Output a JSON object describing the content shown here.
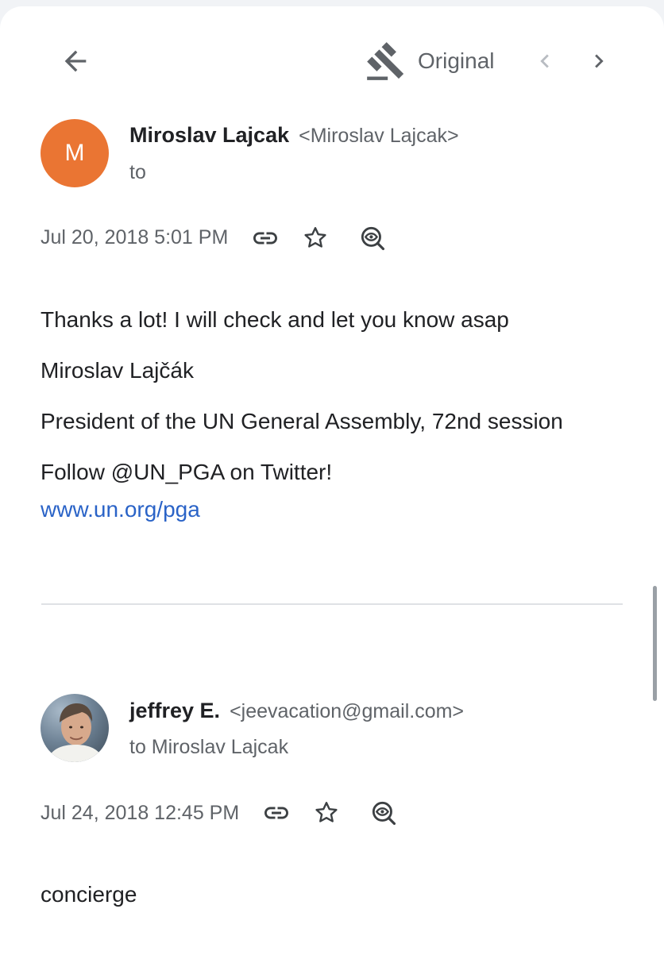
{
  "toolbar": {
    "back_icon": "arrow-back-icon",
    "original_icon": "gavel-icon",
    "original_label": "Original",
    "prev_icon": "chevron-left-icon",
    "next_icon": "chevron-right-icon"
  },
  "messages": [
    {
      "avatar_letter": "M",
      "avatar_color": "#ea7533",
      "sender_name": "Miroslav Lajcak",
      "sender_email": "<Miroslav Lajcak>",
      "recipient": "to",
      "timestamp": "Jul 20, 2018 5:01 PM",
      "icons": [
        "link-icon",
        "star-icon",
        "view-icon"
      ],
      "body": [
        "Thanks a lot! I will check and let you know asap",
        "Miroslav Lajčák",
        "President of the UN General Assembly, 72nd session",
        "Follow @UN_PGA on Twitter!"
      ],
      "link": "www.un.org/pga"
    },
    {
      "avatar_type": "photo",
      "sender_name": "jeffrey E.",
      "sender_email": "<jeevacation@gmail.com>",
      "recipient": "to Miroslav Lajcak",
      "timestamp": "Jul 24, 2018 12:45 PM",
      "icons": [
        "link-icon",
        "star-icon",
        "view-icon"
      ],
      "body": [
        "concierge"
      ]
    }
  ],
  "colors": {
    "accent_link": "#2a63c7",
    "avatar_orange": "#ea7533",
    "text_primary": "#202124",
    "text_secondary": "#5f6368"
  }
}
